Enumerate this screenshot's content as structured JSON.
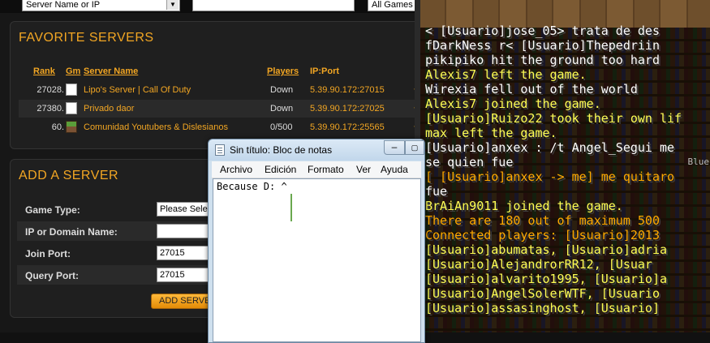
{
  "browser": {
    "search_select": "Server Name or IP",
    "filter_select": "All Games",
    "favorites": {
      "title": "FAVORITE SERVERS",
      "columns": {
        "rank": "Rank",
        "gm": "Gm",
        "name": "Server Name",
        "players": "Players",
        "ip": "IP:Port"
      },
      "rows": [
        {
          "rank": "27028.",
          "gm": "counter-strike-icon",
          "name": "Lipo's Server | Call Of Duty",
          "players": "Down",
          "ip": "5.39.90.172:27015"
        },
        {
          "rank": "27380.",
          "gm": "counter-strike-icon",
          "name": "Privado daor",
          "players": "Down",
          "ip": "5.39.90.172:27025"
        },
        {
          "rank": "60.",
          "gm": "minecraft-icon",
          "name": "Comunidad Youtubers & Dislesianos",
          "players": "0/500",
          "ip": "5.39.90.172:25565"
        }
      ]
    },
    "add": {
      "title": "ADD A SERVER",
      "game_type_label": "Game Type:",
      "game_type_value": "Please Select",
      "ip_label": "IP or Domain Name:",
      "ip_value": "",
      "join_label": "Join Port:",
      "join_value": "27015",
      "query_label": "Query Port:",
      "query_value": "27015",
      "button_label": "ADD SERVER"
    }
  },
  "notepad": {
    "title": "Sin título: Bloc de notas",
    "menu": [
      "Archivo",
      "Edición",
      "Formato",
      "Ver",
      "Ayuda"
    ],
    "text": "Because D: ^"
  },
  "chat": {
    "lines": [
      "< [Usuario]jose_05> trata de des",
      "fDarkNess r<  [Usuario]Thepedriin",
      "pikipiko hit the ground too hard",
      "Alexis7 left the game.",
      "Wirexia fell out of the world",
      "Alexis7 joined the game.",
      " [Usuario]Ruizo22 took their own lif",
      "max left the game.",
      " [Usuario]anxex : /t Angel_Segui me",
      " se quien fue",
      "[ [Usuario]anxex -> me] me quitaro",
      " fue",
      "BrAiAn9011 joined the game.",
      "There are 180 out of maximum 500",
      "Connected players:  [Usuario]2013",
      " [Usuario]abumatas,  [Usuario]adria",
      " [Usuario]AlejandrorRR12,  [Usuar",
      " [Usuario]alvarito1995,  [Usuario]a",
      " [Usuario]AngelSolerWTF,  [Usuario",
      " [Usuario]assasinghost,  [Usuario]"
    ],
    "tag": "Blue"
  },
  "colors": {
    "accent": "#f2a623",
    "chat_yellow": "#ffff55",
    "chat_gold": "#ffaa00",
    "chat_red": "#ff5555"
  }
}
